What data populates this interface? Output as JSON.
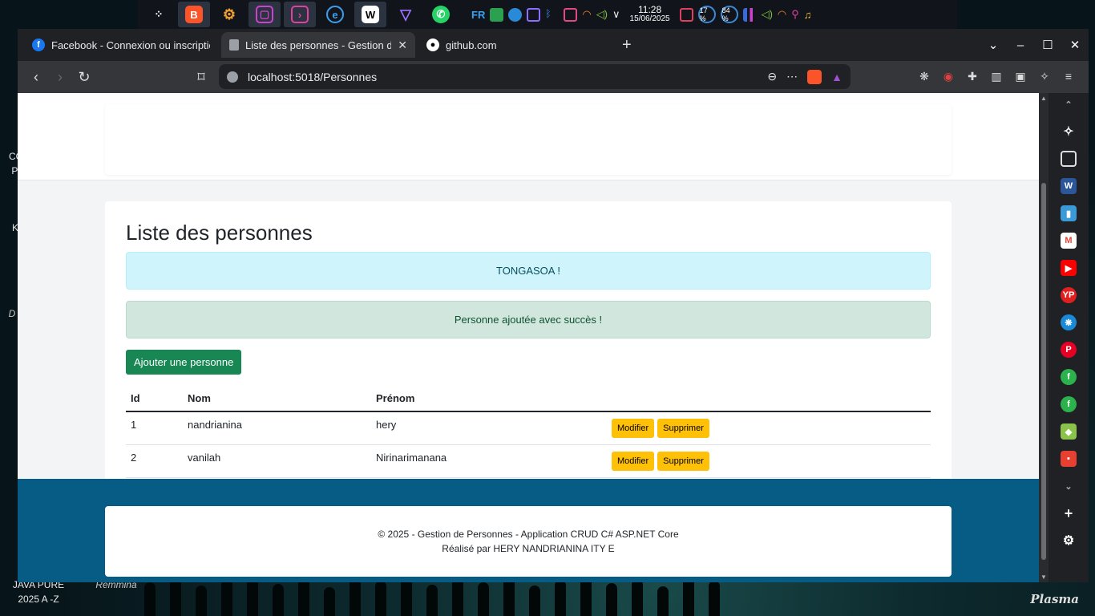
{
  "desktop": {
    "labels": [
      "CO",
      "PI",
      "K",
      "D",
      "JAVA PURE",
      "2025 A -Z",
      "Remmina"
    ],
    "plasma": "Plasma"
  },
  "taskbar": {
    "apps": [
      {
        "icon": "app-launcher-icon"
      },
      {
        "icon": "brave-browser-icon"
      },
      {
        "icon": "settings-icon"
      },
      {
        "icon": "file-manager-icon"
      },
      {
        "icon": "terminal-icon"
      },
      {
        "icon": "app-icon"
      },
      {
        "icon": "wps-icon"
      },
      {
        "icon": "proton-vpn-icon"
      },
      {
        "icon": "whatsapp-icon"
      }
    ],
    "keyboard_layout": "FR",
    "time": "11:28",
    "date": "15/06/2025",
    "cpu": "17 %",
    "mem": "84 %"
  },
  "browser": {
    "tabs": [
      {
        "title": "Facebook - Connexion ou inscription",
        "favicon": "facebook-icon"
      },
      {
        "title": "Liste des personnes - Gestion de Personnes",
        "favicon": "page-icon"
      },
      {
        "title": "github.com",
        "favicon": "github-icon"
      }
    ],
    "url": "localhost:5018/Personnes",
    "new_tab": "+"
  },
  "page": {
    "heading": "Liste des personnes",
    "alert_info": "TONGASOA !",
    "alert_success": "Personne ajoutée avec succès !",
    "add_button": "Ajouter une personne",
    "table": {
      "headers": [
        "Id",
        "Nom",
        "Prénom"
      ],
      "rows": [
        {
          "id": "1",
          "nom": "nandrianina",
          "prenom": "hery"
        },
        {
          "id": "2",
          "nom": "vanilah",
          "prenom": "Nirinarimanana"
        }
      ],
      "edit_label": "Modifier",
      "delete_label": "Supprimer"
    },
    "footer": {
      "line1": "© 2025 - Gestion de Personnes - Application CRUD C# ASP.NET Core",
      "line2": "Réalisé par HERY NANDRIANINA ITY E"
    }
  },
  "colors": {
    "success": "#198754",
    "warning": "#ffc107",
    "footer_bg": "#075c85"
  }
}
